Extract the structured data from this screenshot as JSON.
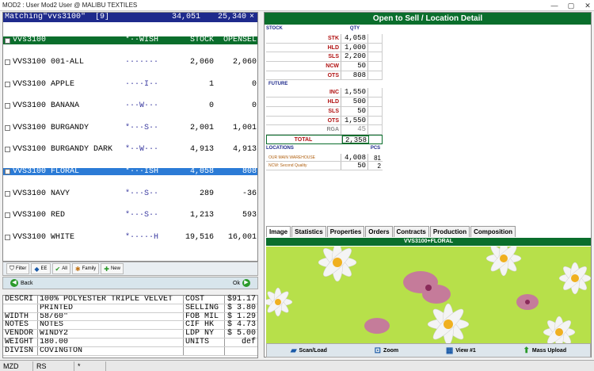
{
  "window": {
    "title": "MOD2 : User Mod2 User @ MALIBU TEXTILES"
  },
  "list": {
    "header": {
      "title": "Matching\"vvs3100\"  [9]",
      "stock": "34,051",
      "opensel": "25,340"
    },
    "rows": [
      {
        "code": "vvs3100",
        "color": "",
        "flags": "*··WISH",
        "stock": "STOCK",
        "open": "OPENSEL"
      },
      {
        "code": "VVS3100",
        "color": "001-ALL",
        "flags": "·······",
        "stock": "2,060",
        "open": "2,060"
      },
      {
        "code": "VVS3100",
        "color": "APPLE",
        "flags": "····I··",
        "stock": "1",
        "open": "0"
      },
      {
        "code": "VVS3100",
        "color": "BANANA",
        "flags": "···W···",
        "stock": "0",
        "open": "0"
      },
      {
        "code": "VVS3100",
        "color": "BURGANDY",
        "flags": "*···S··",
        "stock": "2,001",
        "open": "1,001"
      },
      {
        "code": "VVS3100",
        "color": "BURGANDY DARK",
        "flags": "*··W···",
        "stock": "4,913",
        "open": "4,913"
      },
      {
        "code": "VVS3100",
        "color": "FLORAL",
        "flags": "*···ISH",
        "stock": "4,058",
        "open": "808"
      },
      {
        "code": "VVS3100",
        "color": "NAVY",
        "flags": "*···S··",
        "stock": "289",
        "open": "-36"
      },
      {
        "code": "VVS3100",
        "color": "RED",
        "flags": "*···S··",
        "stock": "1,213",
        "open": "593"
      },
      {
        "code": "VVS3100",
        "color": "WHITE",
        "flags": "*·····H",
        "stock": "19,516",
        "open": "16,001"
      }
    ]
  },
  "toolbar": {
    "filter": "Filter",
    "ee": "EE",
    "all": "All",
    "family": "Family",
    "new": "New"
  },
  "nav": {
    "back": "Back",
    "ok": "Ok"
  },
  "detail": {
    "rows": [
      {
        "l": "DESCRI",
        "v": "100% POLYESTER TRIPLE VELVET",
        "l2": "COST",
        "v2": "$91.17"
      },
      {
        "l": "",
        "v": "PRINTED",
        "l2": "SELLING",
        "v2": "$ 3.80"
      },
      {
        "l": "WIDTH",
        "v": "58/60\"",
        "l2": "FOB MIL",
        "v2": "$ 1.29"
      },
      {
        "l": "NOTES",
        "v": "NOTES",
        "l2": "CIF HK",
        "v2": "$ 4.73"
      },
      {
        "l": "VENDOR",
        "v": "WINDY2",
        "l2": "LDP NY",
        "v2": "$ 5.00"
      },
      {
        "l": "WEIGHT",
        "v": "180.00",
        "l2": "UNITS",
        "v2": "def"
      },
      {
        "l": "DIVISN",
        "v": "COVINGTON",
        "l2": "",
        "v2": ""
      }
    ]
  },
  "ots": {
    "title": "Open to Sell / Location Detail",
    "stock_label": "STOCK",
    "qty_label": "QTY",
    "stock": [
      {
        "l": "STK",
        "v": "4,058"
      },
      {
        "l": "HLD",
        "v": "1,000"
      },
      {
        "l": "SLS",
        "v": "2,200"
      },
      {
        "l": "NCW",
        "v": "50"
      },
      {
        "l": "OTS",
        "v": "808"
      }
    ],
    "future_label": "FUTURE",
    "future": [
      {
        "l": "INC",
        "v": "1,550"
      },
      {
        "l": "HLD",
        "v": "500"
      },
      {
        "l": "SLS",
        "v": "50"
      },
      {
        "l": "OTS",
        "v": "1,550"
      },
      {
        "l": "RGA",
        "v": "45"
      }
    ],
    "total_label": "TOTAL",
    "total": "2,358",
    "locations_label": "LOCATIONS",
    "pcs_label": "PCS",
    "locations": [
      {
        "name": "OUR MAIN WAREHOUSE",
        "qty": "4,008",
        "pcs": "81"
      },
      {
        "name": "NCW: Second Quality",
        "qty": "50",
        "pcs": "2"
      }
    ]
  },
  "tabs": [
    "Image",
    "Statistics",
    "Properties",
    "Orders",
    "Contracts",
    "Production",
    "Composition"
  ],
  "image": {
    "caption": "VVS3100+FLORAL"
  },
  "imgtool": {
    "scan": "Scan/Load",
    "zoom": "Zoom",
    "view": "View #1",
    "upload": "Mass Upload"
  },
  "status": {
    "a": "MZD",
    "b": "RS",
    "c": "*"
  },
  "colors": {
    "green": "#0a6e2c",
    "blue": "#1e2a8c",
    "select": "#2b7bd6",
    "fabric": "#b7e04a"
  }
}
